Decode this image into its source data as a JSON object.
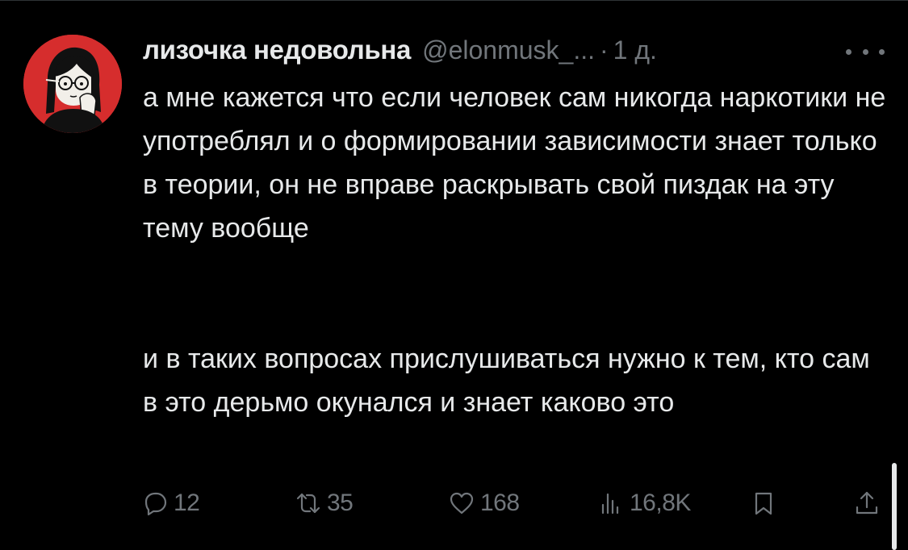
{
  "tweet": {
    "display_name": "лизочка недовольна",
    "handle": "@elonmusk_...",
    "separator": "·",
    "time": "1 д.",
    "paragraphs": [
      "а мне кажется что если человек сам никогда наркотики не употреблял и о формировании зависимости знает только в теории, он не вправе раскрывать свой пиздак на эту тему вообще",
      "и в таких вопросах прислушиваться нужно к тем, кто сам в это дерьмо окунался и знает каково это"
    ]
  },
  "actions": {
    "replies": "12",
    "retweets": "35",
    "likes": "168",
    "views": "16,8K"
  },
  "icons": {
    "more": "more-horizontal-icon",
    "reply": "reply-bubble-icon",
    "retweet": "retweet-arrows-icon",
    "like": "heart-icon",
    "views": "bar-chart-icon",
    "bookmark": "bookmark-icon",
    "share": "share-upload-icon"
  },
  "colors": {
    "background": "#000000",
    "text": "#e7e9ea",
    "secondary": "#71767b",
    "avatar_bg": "#d62d2d"
  }
}
